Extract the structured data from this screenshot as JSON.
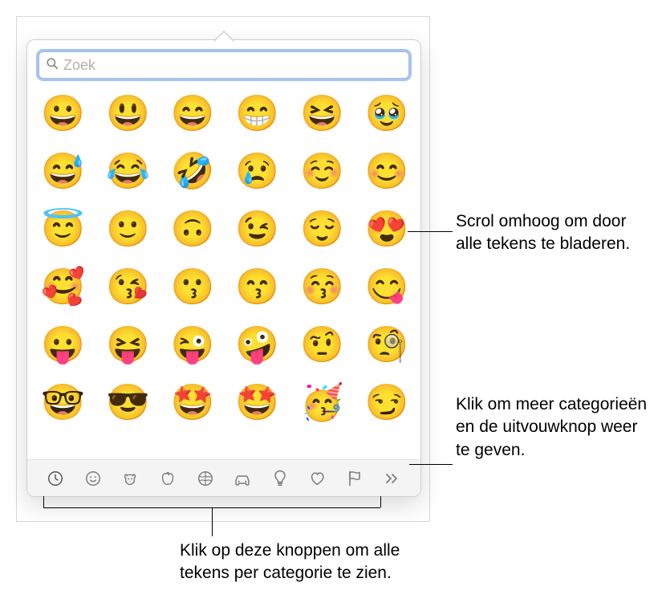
{
  "search": {
    "placeholder": "Zoek",
    "value": ""
  },
  "emoji": {
    "rows": [
      [
        "😀",
        "😃",
        "😄",
        "😁",
        "😆",
        "🥹"
      ],
      [
        "😅",
        "😂",
        "🤣",
        "😢",
        "☺️",
        "😊"
      ],
      [
        "😇",
        "🙂",
        "🙃",
        "😉",
        "😌",
        "😍"
      ],
      [
        "🥰",
        "😘",
        "😗",
        "😙",
        "😚",
        "😋"
      ],
      [
        "😛",
        "😝",
        "😜",
        "🤪",
        "🤨",
        "🧐"
      ],
      [
        "🤓",
        "😎",
        "🤩",
        "🤩",
        "🥳",
        "😏"
      ]
    ]
  },
  "categories": [
    {
      "id": "recent",
      "label": "Recent"
    },
    {
      "id": "smileys",
      "label": "Smileys"
    },
    {
      "id": "animals",
      "label": "Animals"
    },
    {
      "id": "food",
      "label": "Food"
    },
    {
      "id": "activity",
      "label": "Activity"
    },
    {
      "id": "travel",
      "label": "Travel"
    },
    {
      "id": "objects",
      "label": "Objects"
    },
    {
      "id": "symbols",
      "label": "Symbols"
    },
    {
      "id": "flags",
      "label": "Flags"
    },
    {
      "id": "more",
      "label": "More"
    }
  ],
  "callouts": {
    "scroll": "Scrol omhoog om door alle tekens te bladeren.",
    "more": "Klik om meer categorieën en de uitvouwknop weer te geven.",
    "categories": "Klik op deze knoppen om alle tekens per categorie te zien."
  }
}
